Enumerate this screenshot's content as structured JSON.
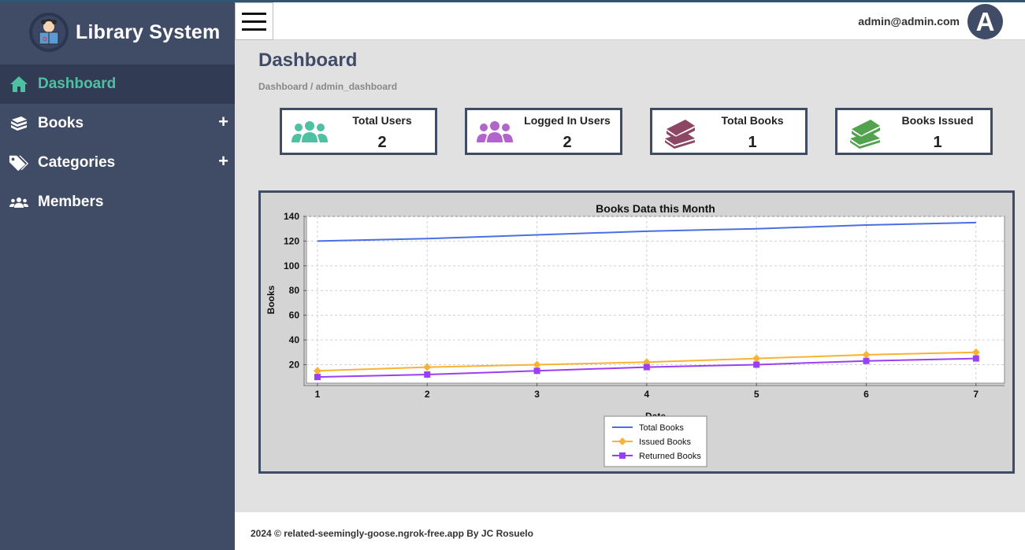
{
  "brand": {
    "name": "Library System"
  },
  "sidebar": {
    "items": [
      {
        "label": "Dashboard",
        "icon": "home-icon",
        "active": true
      },
      {
        "label": "Books",
        "icon": "book-icon",
        "expandable": true
      },
      {
        "label": "Categories",
        "icon": "tags-icon",
        "expandable": true
      },
      {
        "label": "Members",
        "icon": "users-icon"
      }
    ],
    "plus": "+"
  },
  "header": {
    "user_email": "admin@admin.com",
    "avatar_letter": "A"
  },
  "page": {
    "title": "Dashboard",
    "breadcrumb": "Dashboard / admin_dashboard"
  },
  "cards": [
    {
      "label": "Total Users",
      "value": "2",
      "icon": "users-icon",
      "color": "#4fc1a3"
    },
    {
      "label": "Logged In Users",
      "value": "2",
      "icon": "users-icon",
      "color": "#b164c9"
    },
    {
      "label": "Total Books",
      "value": "1",
      "icon": "books-icon",
      "color": "#8b4763"
    },
    {
      "label": "Books Issued",
      "value": "1",
      "icon": "books-icon",
      "color": "#53a250"
    }
  ],
  "colors": {
    "sidebar": "#404b66",
    "accent": "#4fc1a3"
  },
  "chart_data": {
    "type": "line",
    "title": "Books Data this Month",
    "xlabel": "Date",
    "ylabel": "Books",
    "x": [
      1,
      2,
      3,
      4,
      5,
      6,
      7
    ],
    "ylim": [
      5,
      140
    ],
    "yticks": [
      20,
      40,
      60,
      80,
      100,
      120,
      140
    ],
    "grid": true,
    "legend": "bottom-center",
    "series": [
      {
        "name": "Total Books",
        "values": [
          120,
          122,
          125,
          128,
          130,
          133,
          135
        ],
        "color": "#4a6fe3",
        "marker": "none"
      },
      {
        "name": "Issued Books",
        "values": [
          15,
          18,
          20,
          22,
          25,
          28,
          30
        ],
        "color": "#f9b233",
        "marker": "diamond"
      },
      {
        "name": "Returned Books",
        "values": [
          10,
          12,
          15,
          18,
          20,
          23,
          25
        ],
        "color": "#9b3ff5",
        "marker": "square"
      }
    ]
  },
  "footer": {
    "text": "2024 © related-seemingly-goose.ngrok-free.app By JC Rosuelo"
  }
}
